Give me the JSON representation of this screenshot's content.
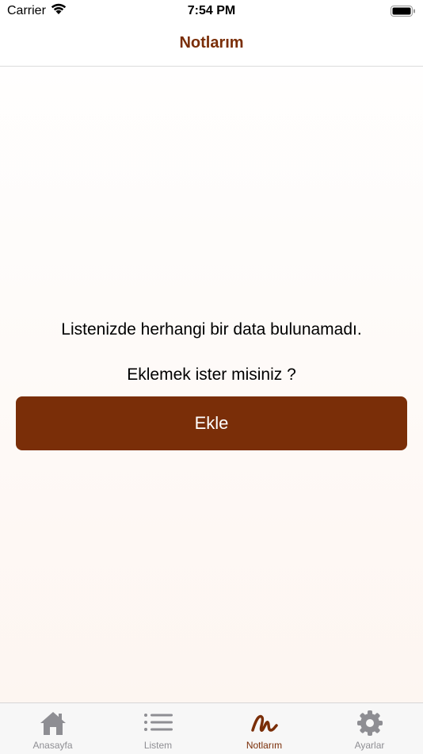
{
  "status_bar": {
    "carrier": "Carrier",
    "time": "7:54 PM"
  },
  "nav": {
    "title": "Notlarım"
  },
  "main": {
    "empty_message": "Listenizde herhangi bir data bulunamadı.",
    "prompt": "Eklemek ister misiniz ?",
    "add_button_label": "Ekle"
  },
  "tabs": [
    {
      "label": "Anasayfa",
      "icon": "house-icon"
    },
    {
      "label": "Listem",
      "icon": "list-icon"
    },
    {
      "label": "Notlarım",
      "icon": "scribble-icon",
      "active": true
    },
    {
      "label": "Ayarlar",
      "icon": "gear-icon"
    }
  ],
  "colors": {
    "accent": "#7a2e08",
    "inactive": "#8e8e93"
  }
}
